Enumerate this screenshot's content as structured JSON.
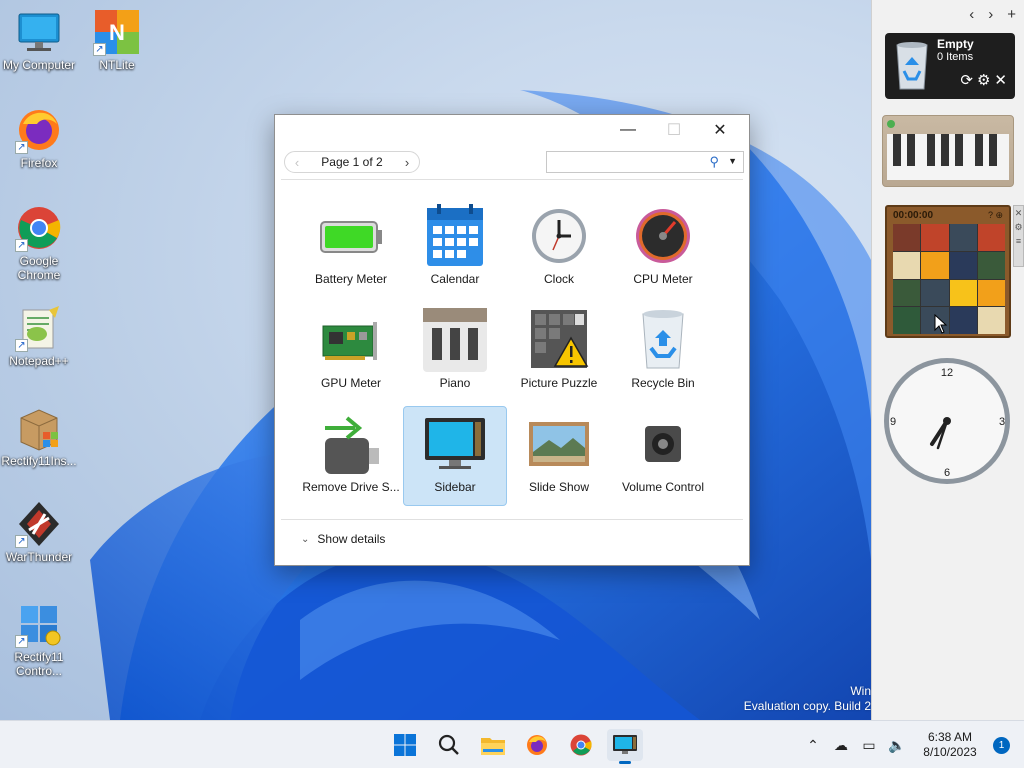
{
  "desktop": {
    "icons": [
      {
        "label": "My Computer",
        "shortcut": false
      },
      {
        "label": "NTLite",
        "shortcut": true
      },
      {
        "label": "Firefox",
        "shortcut": true
      },
      {
        "label": "Google Chrome",
        "shortcut": true
      },
      {
        "label": "Notepad++",
        "shortcut": true
      },
      {
        "label": "Rectify11Ins...",
        "shortcut": false
      },
      {
        "label": "WarThunder",
        "shortcut": true
      },
      {
        "label": "Rectify11 Contro...",
        "shortcut": true
      }
    ],
    "watermark_line1": "Win",
    "watermark_line2": "Evaluation copy. Build 2"
  },
  "gallery": {
    "page_text": "Page 1 of 2",
    "search_value": "",
    "show_details": "Show details",
    "items": [
      {
        "label": "Battery Meter",
        "icon": "battery-icon"
      },
      {
        "label": "Calendar",
        "icon": "calendar-icon"
      },
      {
        "label": "Clock",
        "icon": "clock-icon"
      },
      {
        "label": "CPU Meter",
        "icon": "cpu-meter-icon"
      },
      {
        "label": "GPU Meter",
        "icon": "gpu-card-icon"
      },
      {
        "label": "Piano",
        "icon": "piano-icon"
      },
      {
        "label": "Picture Puzzle",
        "icon": "puzzle-warning-icon"
      },
      {
        "label": "Recycle Bin",
        "icon": "recycle-bin-icon"
      },
      {
        "label": "Remove Drive S...",
        "icon": "usb-drive-icon"
      },
      {
        "label": "Sidebar",
        "icon": "sidebar-monitor-icon",
        "selected": true
      },
      {
        "label": "Slide Show",
        "icon": "slideshow-icon"
      },
      {
        "label": "Volume Control",
        "icon": "speaker-icon"
      }
    ]
  },
  "sidebar": {
    "recycle": {
      "title": "Empty",
      "count": "0 Items"
    },
    "puzzle_time": "00:00:00",
    "clock": {
      "n12": "12",
      "n3": "3",
      "n6": "6",
      "n9": "9"
    }
  },
  "taskbar": {
    "time": "6:38 AM",
    "date": "8/10/2023",
    "notifications": "1"
  },
  "colors": {
    "accent": "#0067c0",
    "selection": "#cce4f7"
  }
}
